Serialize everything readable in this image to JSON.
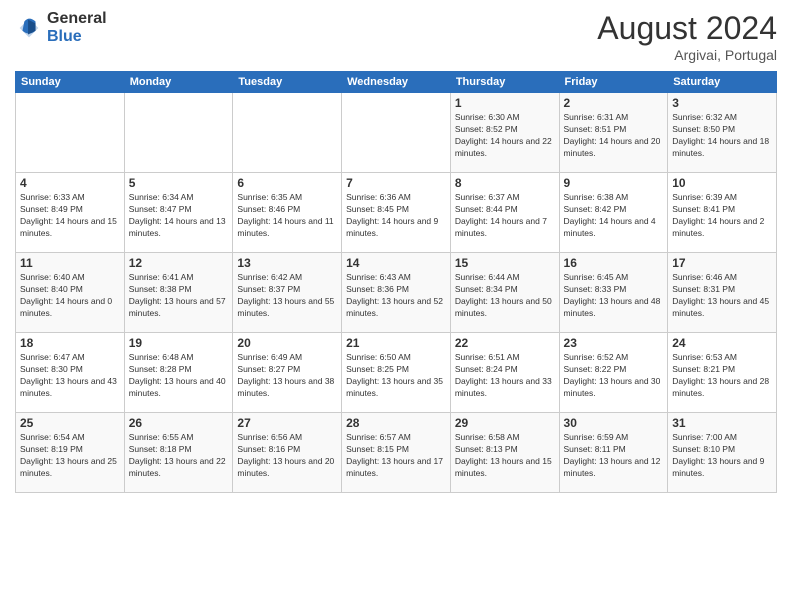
{
  "logo": {
    "general": "General",
    "blue": "Blue"
  },
  "title": {
    "month_year": "August 2024",
    "location": "Argivai, Portugal"
  },
  "days_of_week": [
    "Sunday",
    "Monday",
    "Tuesday",
    "Wednesday",
    "Thursday",
    "Friday",
    "Saturday"
  ],
  "weeks": [
    [
      {
        "day": "",
        "info": ""
      },
      {
        "day": "",
        "info": ""
      },
      {
        "day": "",
        "info": ""
      },
      {
        "day": "",
        "info": ""
      },
      {
        "day": "1",
        "info": "Sunrise: 6:30 AM\nSunset: 8:52 PM\nDaylight: 14 hours and 22 minutes."
      },
      {
        "day": "2",
        "info": "Sunrise: 6:31 AM\nSunset: 8:51 PM\nDaylight: 14 hours and 20 minutes."
      },
      {
        "day": "3",
        "info": "Sunrise: 6:32 AM\nSunset: 8:50 PM\nDaylight: 14 hours and 18 minutes."
      }
    ],
    [
      {
        "day": "4",
        "info": "Sunrise: 6:33 AM\nSunset: 8:49 PM\nDaylight: 14 hours and 15 minutes."
      },
      {
        "day": "5",
        "info": "Sunrise: 6:34 AM\nSunset: 8:47 PM\nDaylight: 14 hours and 13 minutes."
      },
      {
        "day": "6",
        "info": "Sunrise: 6:35 AM\nSunset: 8:46 PM\nDaylight: 14 hours and 11 minutes."
      },
      {
        "day": "7",
        "info": "Sunrise: 6:36 AM\nSunset: 8:45 PM\nDaylight: 14 hours and 9 minutes."
      },
      {
        "day": "8",
        "info": "Sunrise: 6:37 AM\nSunset: 8:44 PM\nDaylight: 14 hours and 7 minutes."
      },
      {
        "day": "9",
        "info": "Sunrise: 6:38 AM\nSunset: 8:42 PM\nDaylight: 14 hours and 4 minutes."
      },
      {
        "day": "10",
        "info": "Sunrise: 6:39 AM\nSunset: 8:41 PM\nDaylight: 14 hours and 2 minutes."
      }
    ],
    [
      {
        "day": "11",
        "info": "Sunrise: 6:40 AM\nSunset: 8:40 PM\nDaylight: 14 hours and 0 minutes."
      },
      {
        "day": "12",
        "info": "Sunrise: 6:41 AM\nSunset: 8:38 PM\nDaylight: 13 hours and 57 minutes."
      },
      {
        "day": "13",
        "info": "Sunrise: 6:42 AM\nSunset: 8:37 PM\nDaylight: 13 hours and 55 minutes."
      },
      {
        "day": "14",
        "info": "Sunrise: 6:43 AM\nSunset: 8:36 PM\nDaylight: 13 hours and 52 minutes."
      },
      {
        "day": "15",
        "info": "Sunrise: 6:44 AM\nSunset: 8:34 PM\nDaylight: 13 hours and 50 minutes."
      },
      {
        "day": "16",
        "info": "Sunrise: 6:45 AM\nSunset: 8:33 PM\nDaylight: 13 hours and 48 minutes."
      },
      {
        "day": "17",
        "info": "Sunrise: 6:46 AM\nSunset: 8:31 PM\nDaylight: 13 hours and 45 minutes."
      }
    ],
    [
      {
        "day": "18",
        "info": "Sunrise: 6:47 AM\nSunset: 8:30 PM\nDaylight: 13 hours and 43 minutes."
      },
      {
        "day": "19",
        "info": "Sunrise: 6:48 AM\nSunset: 8:28 PM\nDaylight: 13 hours and 40 minutes."
      },
      {
        "day": "20",
        "info": "Sunrise: 6:49 AM\nSunset: 8:27 PM\nDaylight: 13 hours and 38 minutes."
      },
      {
        "day": "21",
        "info": "Sunrise: 6:50 AM\nSunset: 8:25 PM\nDaylight: 13 hours and 35 minutes."
      },
      {
        "day": "22",
        "info": "Sunrise: 6:51 AM\nSunset: 8:24 PM\nDaylight: 13 hours and 33 minutes."
      },
      {
        "day": "23",
        "info": "Sunrise: 6:52 AM\nSunset: 8:22 PM\nDaylight: 13 hours and 30 minutes."
      },
      {
        "day": "24",
        "info": "Sunrise: 6:53 AM\nSunset: 8:21 PM\nDaylight: 13 hours and 28 minutes."
      }
    ],
    [
      {
        "day": "25",
        "info": "Sunrise: 6:54 AM\nSunset: 8:19 PM\nDaylight: 13 hours and 25 minutes."
      },
      {
        "day": "26",
        "info": "Sunrise: 6:55 AM\nSunset: 8:18 PM\nDaylight: 13 hours and 22 minutes."
      },
      {
        "day": "27",
        "info": "Sunrise: 6:56 AM\nSunset: 8:16 PM\nDaylight: 13 hours and 20 minutes."
      },
      {
        "day": "28",
        "info": "Sunrise: 6:57 AM\nSunset: 8:15 PM\nDaylight: 13 hours and 17 minutes."
      },
      {
        "day": "29",
        "info": "Sunrise: 6:58 AM\nSunset: 8:13 PM\nDaylight: 13 hours and 15 minutes."
      },
      {
        "day": "30",
        "info": "Sunrise: 6:59 AM\nSunset: 8:11 PM\nDaylight: 13 hours and 12 minutes."
      },
      {
        "day": "31",
        "info": "Sunrise: 7:00 AM\nSunset: 8:10 PM\nDaylight: 13 hours and 9 minutes."
      }
    ]
  ]
}
